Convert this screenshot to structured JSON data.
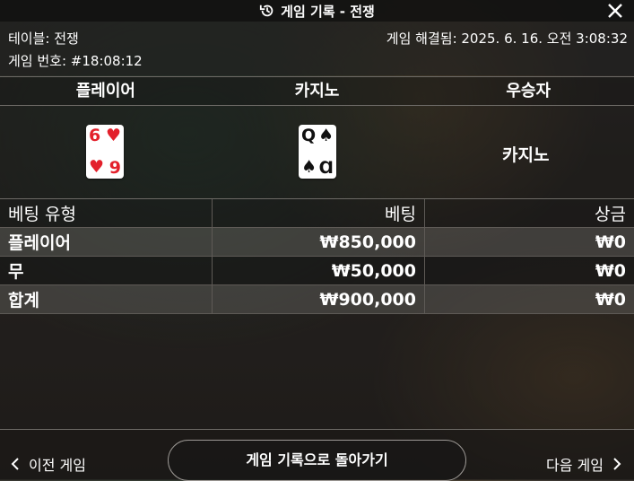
{
  "header": {
    "title": "게임 기록 - 전쟁"
  },
  "info": {
    "table": "테이블: 전쟁",
    "game_number": "게임 번호: #18:08:12",
    "resolved": "게임 해결됨: 2025. 6. 16. 오전 3:08:32"
  },
  "result": {
    "columns": [
      "플레이어",
      "카지노",
      "우승자"
    ],
    "player_card": {
      "rank": "6",
      "rank_bottom": "9",
      "suit": "♥"
    },
    "casino_card": {
      "rank": "Q",
      "rank_bottom": "Ɑ",
      "suit": "♠"
    },
    "winner": "카지노"
  },
  "bets": {
    "headers": [
      "베팅 유형",
      "베팅",
      "상금"
    ],
    "rows": [
      {
        "type": "플레이어",
        "bet": "₩850,000",
        "prize": "₩0"
      },
      {
        "type": "무",
        "bet": "₩50,000",
        "prize": "₩0"
      },
      {
        "type": "합계",
        "bet": "₩900,000",
        "prize": "₩0"
      }
    ]
  },
  "footer": {
    "prev": "이전 게임",
    "back": "게임 기록으로 돌아가기",
    "next": "다음 게임"
  }
}
